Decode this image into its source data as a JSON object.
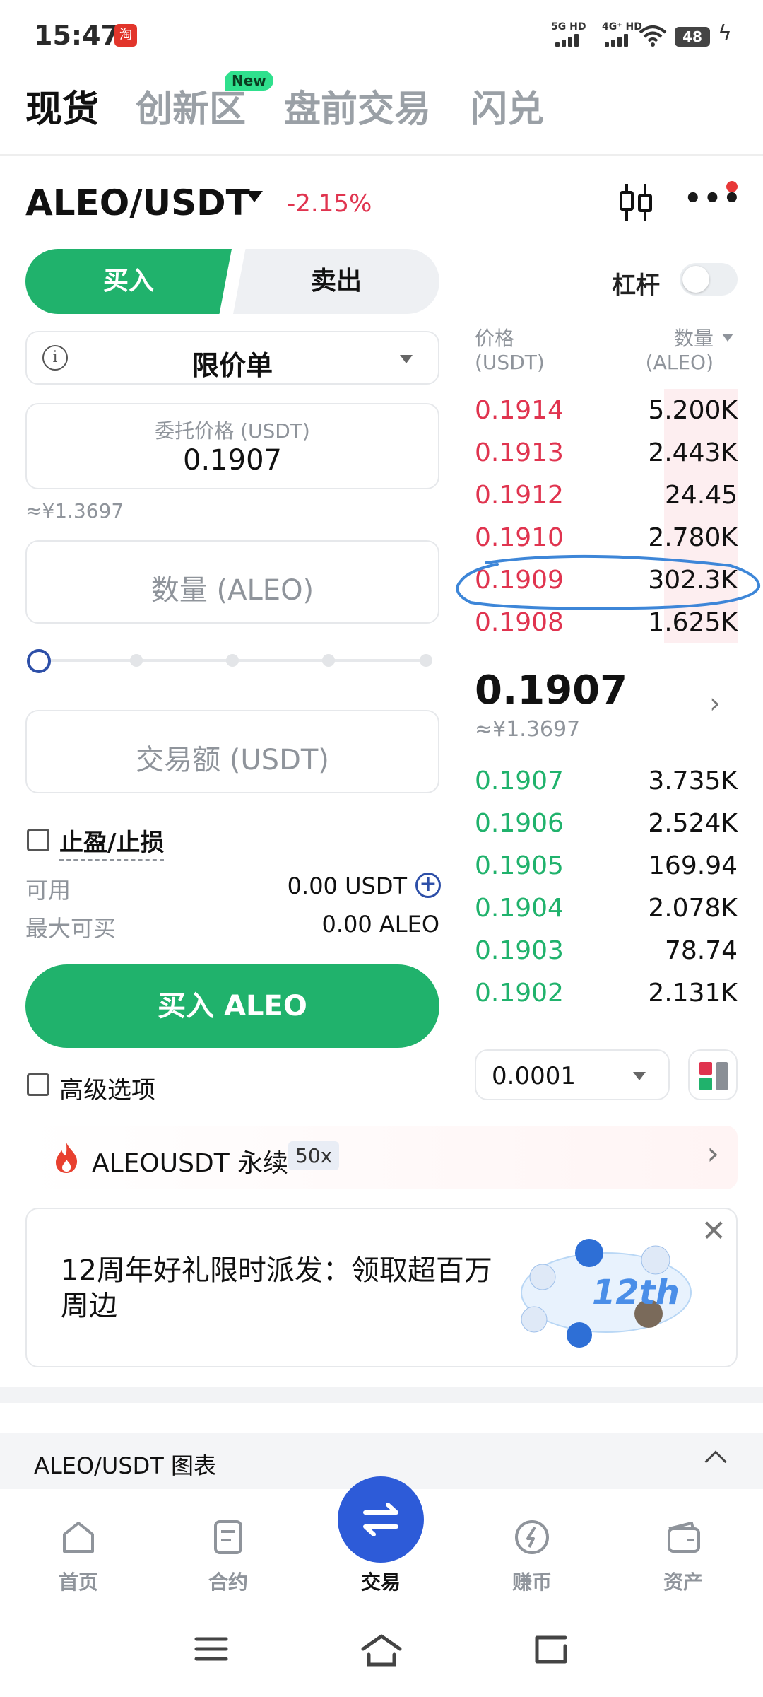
{
  "status_bar": {
    "time": "15:47",
    "app_badge": "淘",
    "sig1": "5G HD",
    "sig2": "4G⁺ HD",
    "battery": "48"
  },
  "top_tabs": [
    {
      "label": "现货"
    },
    {
      "label": "创新区"
    },
    {
      "label": "盘前交易"
    },
    {
      "label": "闪兑"
    }
  ],
  "new_badge": "New",
  "pair": {
    "symbol": "ALEO/USDT",
    "change": "-2.15%"
  },
  "trade_side": {
    "buy": "买入",
    "sell": "卖出"
  },
  "leverage_label": "杠杆",
  "order_type": "限价单",
  "price_field": {
    "label": "委托价格 (USDT)",
    "value": "0.1907"
  },
  "price_cny": "≈¥1.3697",
  "qty_placeholder": "数量 (ALEO)",
  "amount_placeholder": "交易额 (USDT)",
  "tpsl_label": "止盈/止损",
  "available": {
    "label": "可用",
    "value": "0.00 USDT"
  },
  "max_buy": {
    "label": "最大可买",
    "value": "0.00 ALEO"
  },
  "buy_button": "买入 ALEO",
  "advanced_label": "高级选项",
  "orderbook": {
    "price_header": "价格",
    "price_unit": "(USDT)",
    "qty_header": "数量",
    "qty_unit": "(ALEO)",
    "asks": [
      {
        "price": "0.1914",
        "qty": "5.200K",
        "depth": 0.28
      },
      {
        "price": "0.1913",
        "qty": "2.443K",
        "depth": 0.0
      },
      {
        "price": "0.1912",
        "qty": "24.45",
        "depth": 0.0
      },
      {
        "price": "0.1910",
        "qty": "2.780K",
        "depth": 0.0
      },
      {
        "price": "0.1909",
        "qty": "302.3K",
        "depth": 0.0
      },
      {
        "price": "0.1908",
        "qty": "1.625K",
        "depth": 0.0
      }
    ],
    "last_price": "0.1907",
    "last_price_cny": "≈¥1.3697",
    "bids": [
      {
        "price": "0.1907",
        "qty": "3.735K"
      },
      {
        "price": "0.1906",
        "qty": "2.524K"
      },
      {
        "price": "0.1905",
        "qty": "169.94"
      },
      {
        "price": "0.1904",
        "qty": "2.078K"
      },
      {
        "price": "0.1903",
        "qty": "78.74"
      },
      {
        "price": "0.1902",
        "qty": "2.131K"
      }
    ],
    "tick_size": "0.0001"
  },
  "perp_banner": {
    "label": "ALEOUSDT 永续",
    "leverage": "50x"
  },
  "promo": {
    "text": "12周年好礼限时派发：领取超百万周边",
    "art_text": "12th"
  },
  "chart_section": {
    "label": "ALEO/USDT 图表"
  },
  "bottom_nav": [
    {
      "label": "首页"
    },
    {
      "label": "合约"
    },
    {
      "label": "交易"
    },
    {
      "label": "赚币"
    },
    {
      "label": "资产"
    }
  ],
  "colors": {
    "buy": "#20b26c",
    "sell": "#e0344f",
    "accent": "#2d5bd8",
    "annotation": "#3d86d8"
  }
}
